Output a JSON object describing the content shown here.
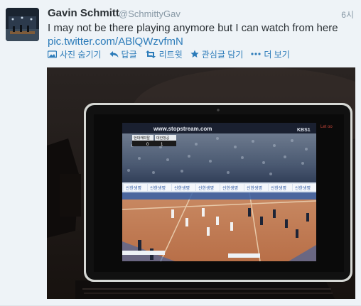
{
  "tweet": {
    "name": "Gavin Schmitt",
    "handle": "@SchmittyGav",
    "time": "6시",
    "text": "I may not be there playing anymore but I can watch from here",
    "link": "pic.twitter.com/ABlQWzvfmN"
  },
  "actions": {
    "hide_photo": "사진 숨기기",
    "reply": "답글",
    "retweet": "리트윗",
    "favorite": "관심글 담기",
    "more": "더 보기"
  },
  "photo": {
    "url_overlay": "www.stopstream.com",
    "channel_logo": "KBS1",
    "live_tag": "Let oo",
    "scoreboard": {
      "team_a": "현대캐피탈",
      "team_b": "대한항공",
      "score_a": "0",
      "score_b": "1"
    },
    "ad_boards": [
      "신한생명",
      "신한생명",
      "신한생명",
      "신한생명",
      "신한생명",
      "신한생명",
      "신한생명",
      "신한생명"
    ]
  },
  "colors": {
    "link": "#2b7bb9",
    "background": "#eef3f7",
    "court": "#c97e55"
  },
  "icons": [
    "photo-icon",
    "reply-icon",
    "retweet-icon",
    "star-icon",
    "more-dots-icon"
  ]
}
